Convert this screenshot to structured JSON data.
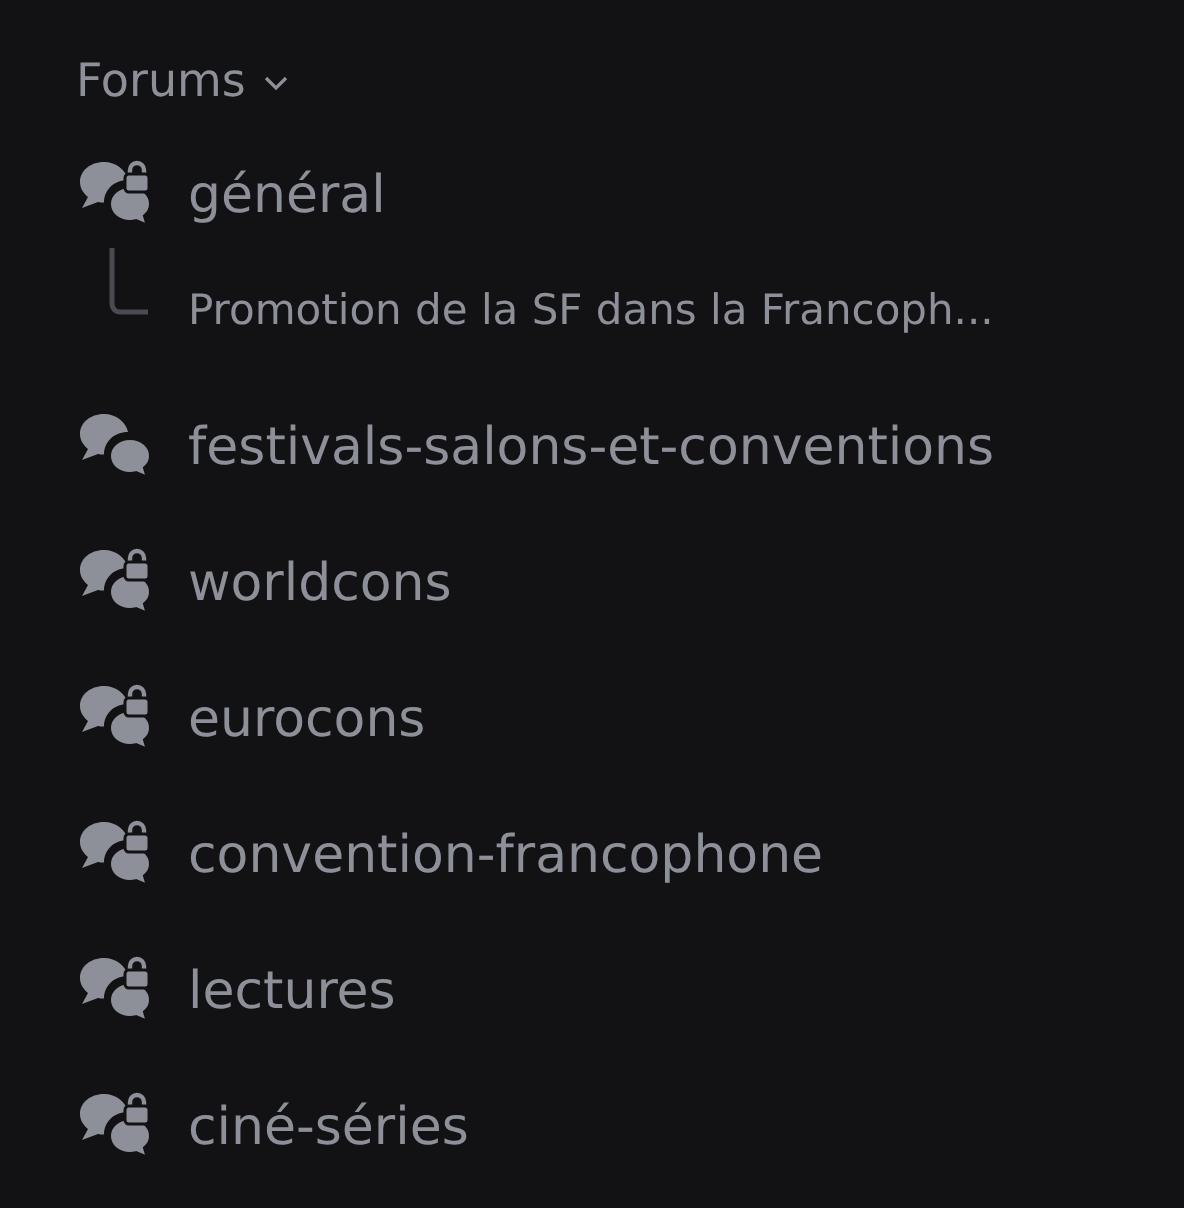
{
  "section": {
    "title": "Forums",
    "expanded": true
  },
  "channels": [
    {
      "name": "général",
      "locked": true,
      "threads": [
        {
          "title": "Promotion de la SF dans la Francoph..."
        }
      ]
    },
    {
      "name": "festivals-salons-et-conventions",
      "locked": false
    },
    {
      "name": "worldcons",
      "locked": true
    },
    {
      "name": "eurocons",
      "locked": true
    },
    {
      "name": "convention-francophone",
      "locked": true
    },
    {
      "name": "lectures",
      "locked": true
    },
    {
      "name": "ciné-séries",
      "locked": true
    }
  ]
}
